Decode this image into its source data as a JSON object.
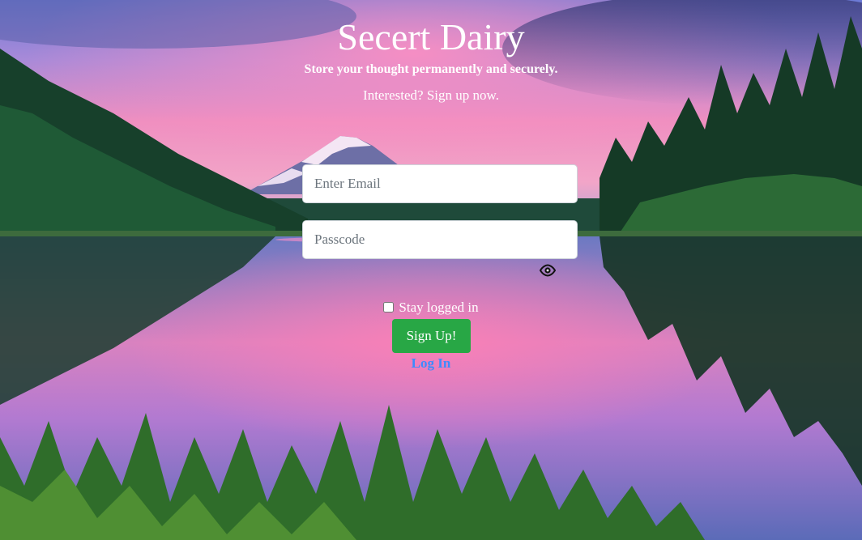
{
  "header": {
    "title": "Secert Dairy",
    "tagline": "Store your thought permanently and securely.",
    "prompt": "Interested? Sign up now."
  },
  "form": {
    "email": {
      "placeholder": "Enter Email",
      "value": ""
    },
    "passcode": {
      "placeholder": "Passcode",
      "value": ""
    },
    "show_password_icon": "eye-icon",
    "remember_label": "Stay logged in",
    "remember_checked": false,
    "submit_label": "Sign Up!",
    "submit_color": "#28a745",
    "switch_link_label": "Log In",
    "link_color": "#3d8bfd"
  },
  "background": {
    "description_icon": "mountain-lake-landscape"
  }
}
